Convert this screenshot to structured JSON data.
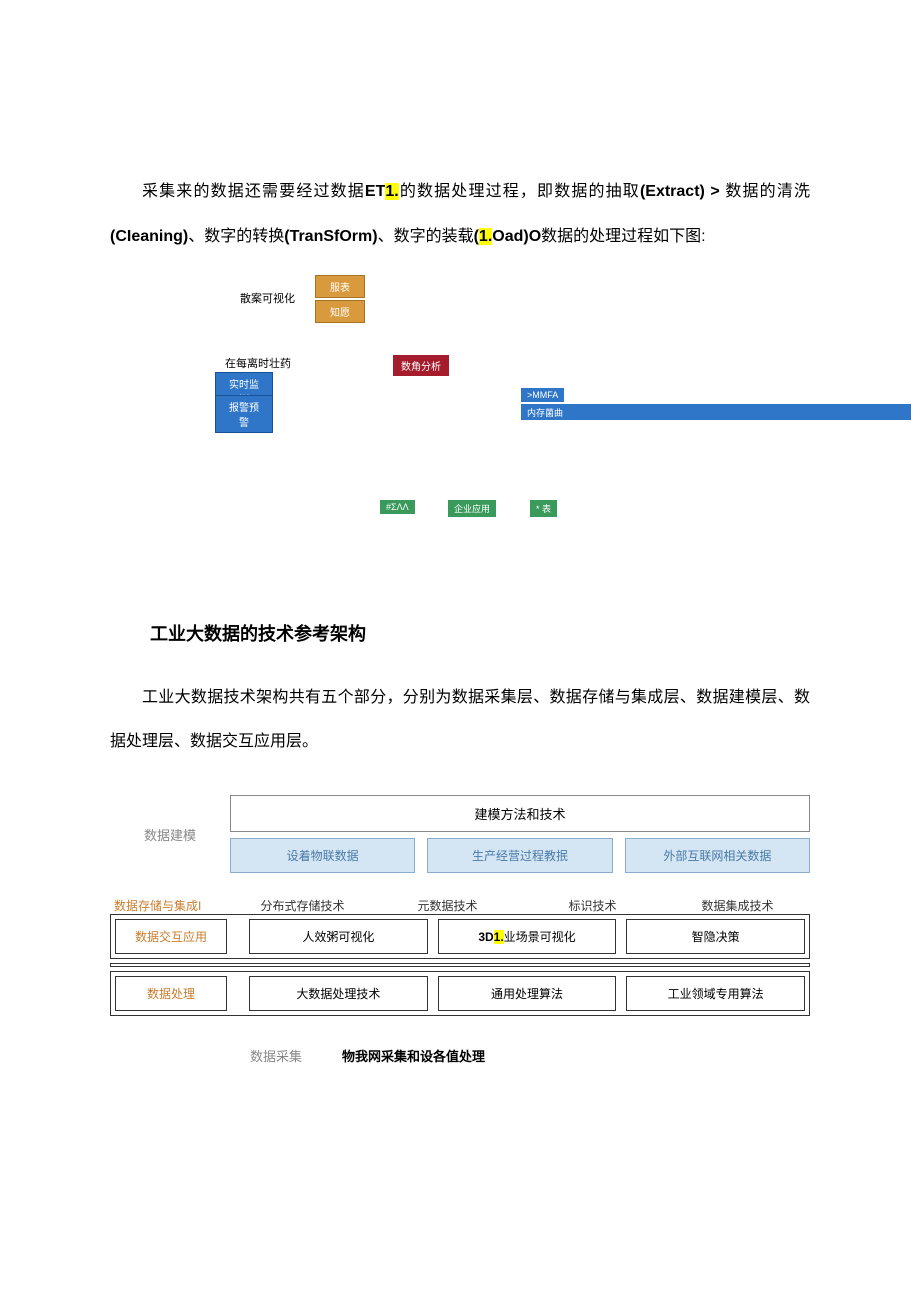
{
  "para1": {
    "pre": "采集来的数据还需要经过数据",
    "bold1": "ET",
    "hl1": "1.",
    "mid1": "的数据处理过程，即数据的抽取",
    "bold2": "(Extract) >",
    "post1": " 数据的清洗",
    "bold3": "(CIeaning)",
    "mid2": "、数字的转换",
    "bold4": "(TranSfOrm)",
    "mid3": "、数字的装载",
    "bold5a": "(",
    "hl2": "1.",
    "bold5b": "Oad)O",
    "post2": "数据的处理过程如下图:"
  },
  "diagram1": {
    "vis_label": "散案可视化",
    "orange1": "服表",
    "orange2": "知愿",
    "online_label": "在每离时壮药",
    "blue1": "实时监测",
    "blue2": "报警预警",
    "red": "数角分析",
    "mmea": ">MMFA",
    "bar": "内存菌曲",
    "green1": "#ΣΛΛ",
    "green2": "企业应用",
    "green3": "* 表"
  },
  "heading2": "工业大数据的技术参考架构",
  "para2": "工业大数据技术架构共有五个部分，分别为数据采集层、数据存储与集成层、数据建模层、数据处理层、数据交互应用层。",
  "diagram2": {
    "row1_label": "数据建模",
    "row1_full": "建模方法和技术",
    "row1_blue": [
      "设着物联数据",
      "生产经营过程教抿",
      "外部互联网相关数据"
    ],
    "header_side": "数据存储与集成I",
    "header_cols": [
      "分布式存储技术",
      "元数据技术",
      "标识技术",
      "数据集成技术"
    ],
    "row2_label": "数据交互应用",
    "row2_cells_a": "人效粥可视化",
    "row2_cells_b_pre": "3D",
    "row2_cells_b_hl": "1.",
    "row2_cells_b_post": "业场景可视化",
    "row2_cells_c": "智隐决策",
    "row3_label": "数据处理",
    "row3_cells": [
      "大数据处理技术",
      "通用处理算法",
      "工业领域专用算法"
    ],
    "bottom_label": "数据采集",
    "bottom_text": "物我网采集和设各值处理"
  }
}
